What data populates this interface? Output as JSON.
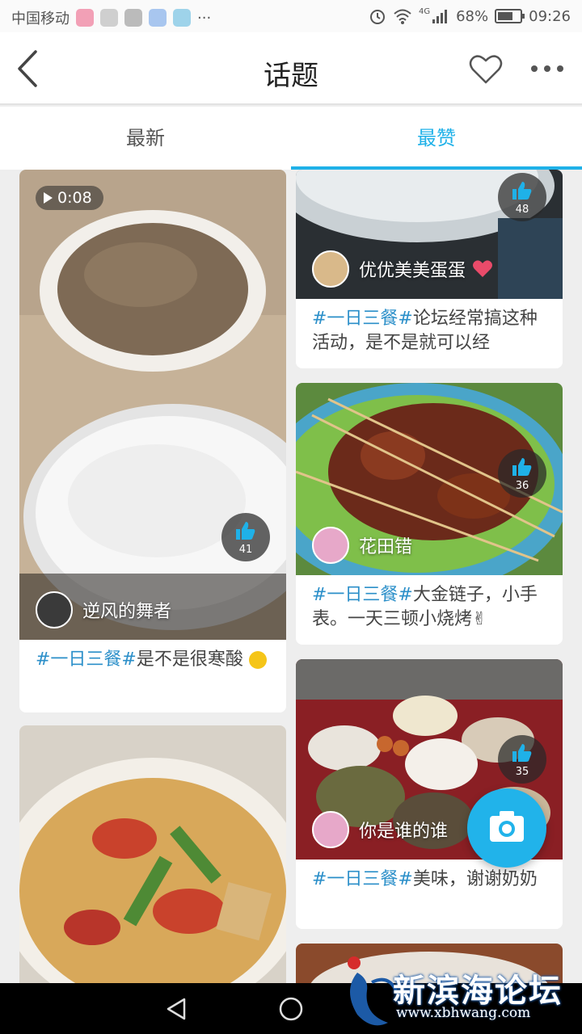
{
  "status_bar": {
    "carrier": "中国移动",
    "more": "···",
    "network": "4G",
    "battery_text": "68%",
    "battery_level": 0.68,
    "time": "09:26"
  },
  "header": {
    "title": "话题"
  },
  "tabs": [
    {
      "label": "最新",
      "active": false
    },
    {
      "label": "最赞",
      "active": true
    }
  ],
  "posts": [
    {
      "author": "逆风的舞者",
      "likes": "41",
      "duration": "0:08",
      "hashtag": "#一日三餐#",
      "text": "是不是很寒酸"
    },
    {
      "author": "优优美美蛋蛋",
      "likes": "48",
      "hashtag": "#一日三餐#",
      "text": "论坛经常搞这种活动，是不是就可以经"
    },
    {
      "author": "花田错",
      "likes": "36",
      "hashtag": "#一日三餐#",
      "text": "大金链子，小手表。一天三顿小烧烤✌"
    },
    {
      "author": "你是谁的谁",
      "likes": "35",
      "hashtag": "#一日三餐#",
      "text": "美味，谢谢奶奶"
    }
  ],
  "watermark": {
    "name": "新滨海论坛",
    "url": "www.xbhwang.com"
  },
  "colors": {
    "accent": "#1fb1e8",
    "hashtag": "#2b8fc9",
    "fab": "#21b3ea"
  }
}
